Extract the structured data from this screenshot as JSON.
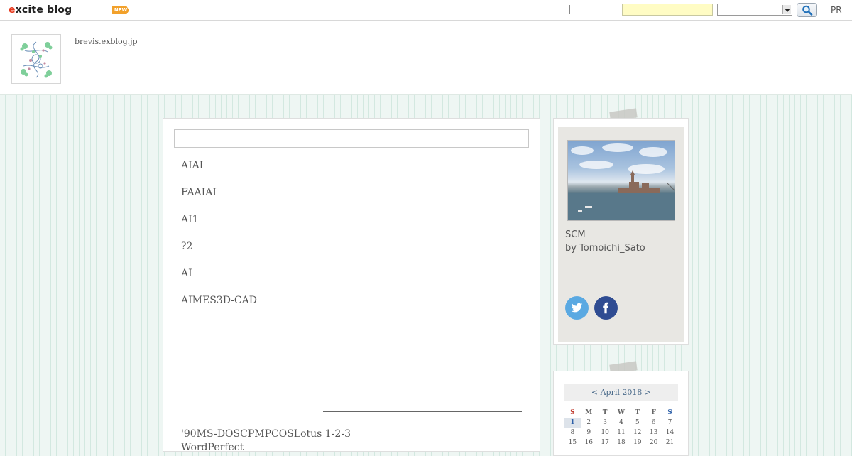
{
  "topbar": {
    "logo_text": "excite blog",
    "new_badge": "NEW",
    "search_placeholder": "",
    "search_option": "",
    "pr_link": "PR"
  },
  "header": {
    "blog_url": "brevis.exblog.jp"
  },
  "main": {
    "title_box": "",
    "entries": [
      "AIAI",
      "FAAIAI",
      "AI1",
      "?2",
      "AI",
      "AIMES3D-CAD"
    ],
    "body_lines": [
      "'90MS-DOSCPMPCOSLotus 1-2-3",
      "WordPerfect"
    ]
  },
  "profile": {
    "name": "SCM",
    "by": "by Tomoichi_Sato",
    "twitter_icon": "twitter-icon",
    "facebook_icon": "facebook-icon"
  },
  "calendar": {
    "prev": "<",
    "month": "April 2018",
    "next": ">",
    "weekdays": [
      "S",
      "M",
      "T",
      "W",
      "T",
      "F",
      "S"
    ],
    "weeks": [
      [
        "1",
        "2",
        "3",
        "4",
        "5",
        "6",
        "7"
      ],
      [
        "8",
        "9",
        "10",
        "11",
        "12",
        "13",
        "14"
      ],
      [
        "15",
        "16",
        "17",
        "18",
        "19",
        "20",
        "21"
      ]
    ],
    "today": "1"
  },
  "colors": {
    "background": "#eef6f3",
    "search_field": "#fffcc4",
    "new_badge": "#f2a12b",
    "twitter": "#5aa9e2",
    "facebook": "#2f4c92"
  }
}
